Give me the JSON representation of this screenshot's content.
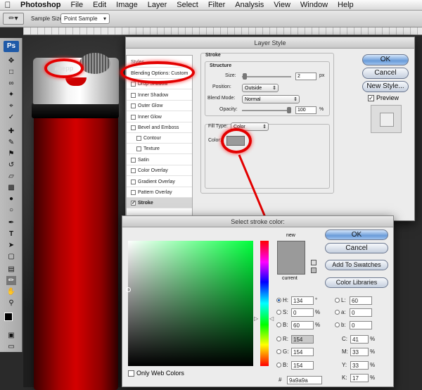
{
  "menubar": {
    "apple": "",
    "app": "Photoshop",
    "items": [
      "File",
      "Edit",
      "Image",
      "Layer",
      "Select",
      "Filter",
      "Analysis",
      "View",
      "Window",
      "Help"
    ]
  },
  "options_bar": {
    "sample_size_label": "Sample Size:",
    "sample_size_value": "Point Sample"
  },
  "toolbox": {
    "logo": "Ps",
    "tools": [
      "move-icon",
      "marquee-icon",
      "lasso-icon",
      "magic-wand-icon",
      "crop-icon",
      "eyedropper-icon",
      "healing-icon",
      "brush-icon",
      "stamp-icon",
      "history-brush-icon",
      "eraser-icon",
      "gradient-icon",
      "blur-icon",
      "dodge-icon",
      "pen-icon",
      "type-icon",
      "path-select-icon",
      "shape-icon",
      "notes-icon",
      "eyedropper-icon",
      "hand-icon",
      "zoom-icon"
    ]
  },
  "canvas": {
    "label": "apepp"
  },
  "layer_style": {
    "title": "Layer Style",
    "styles_header": "Styles",
    "styles": [
      {
        "label": "Blending Options: Custom",
        "checkbox": false,
        "selected": false
      },
      {
        "label": "Drop Shadow",
        "checkbox": true,
        "checked": false
      },
      {
        "label": "Inner Shadow",
        "checkbox": true,
        "checked": false
      },
      {
        "label": "Outer Glow",
        "checkbox": true,
        "checked": false
      },
      {
        "label": "Inner Glow",
        "checkbox": true,
        "checked": false
      },
      {
        "label": "Bevel and Emboss",
        "checkbox": true,
        "checked": false
      },
      {
        "label": "Contour",
        "checkbox": true,
        "checked": false,
        "indent": true
      },
      {
        "label": "Texture",
        "checkbox": true,
        "checked": false,
        "indent": true
      },
      {
        "label": "Satin",
        "checkbox": true,
        "checked": false
      },
      {
        "label": "Color Overlay",
        "checkbox": true,
        "checked": false
      },
      {
        "label": "Gradient Overlay",
        "checkbox": true,
        "checked": false
      },
      {
        "label": "Pattern Overlay",
        "checkbox": true,
        "checked": false
      },
      {
        "label": "Stroke",
        "checkbox": true,
        "checked": true,
        "selected": true
      }
    ],
    "stroke": {
      "title": "Stroke",
      "structure_title": "Structure",
      "size_label": "Size:",
      "size_value": "2",
      "size_unit": "px",
      "size_slider": 0.02,
      "position_label": "Position:",
      "position_value": "Outside",
      "blend_label": "Blend Mode:",
      "blend_value": "Normal",
      "opacity_label": "Opacity:",
      "opacity_value": "100",
      "opacity_unit": "%",
      "opacity_slider": 1.0,
      "fill_type_label": "Fill Type:",
      "fill_type_value": "Color",
      "color_label": "Color:",
      "color_swatch": "#9a9a9a"
    },
    "buttons": {
      "ok": "OK",
      "cancel": "Cancel",
      "new_style": "New Style..."
    },
    "preview_label": "Preview",
    "preview_checked": true
  },
  "color_picker": {
    "title": "Select stroke color:",
    "new_label": "new",
    "current_label": "current",
    "new_color": "#9a9a9a",
    "current_color": "#9a9a9a",
    "buttons": {
      "ok": "OK",
      "cancel": "Cancel",
      "add_swatches": "Add To Swatches",
      "libraries": "Color Libraries"
    },
    "hsb": [
      {
        "key": "H:",
        "value": "134",
        "unit": "°",
        "selected": true
      },
      {
        "key": "S:",
        "value": "0",
        "unit": "%",
        "selected": false
      },
      {
        "key": "B:",
        "value": "60",
        "unit": "%",
        "selected": false
      }
    ],
    "rgb": [
      {
        "key": "R:",
        "value": "154",
        "selected": false
      },
      {
        "key": "G:",
        "value": "154",
        "selected": false
      },
      {
        "key": "B:",
        "value": "154",
        "selected": false
      }
    ],
    "lab": [
      {
        "key": "L:",
        "value": "60",
        "selected": false
      },
      {
        "key": "a:",
        "value": "0",
        "selected": false
      },
      {
        "key": "b:",
        "value": "0",
        "selected": false
      }
    ],
    "cmyk": [
      {
        "key": "C:",
        "value": "41",
        "unit": "%"
      },
      {
        "key": "M:",
        "value": "33",
        "unit": "%"
      },
      {
        "key": "Y:",
        "value": "33",
        "unit": "%"
      },
      {
        "key": "K:",
        "value": "17",
        "unit": "%"
      }
    ],
    "hex_label": "#",
    "hex_value": "9a9a9a",
    "web_colors_label": "Only Web Colors",
    "web_colors_checked": false
  },
  "colors": {
    "highlight": "#e30000",
    "aqua_default": "#6a9cd9"
  }
}
